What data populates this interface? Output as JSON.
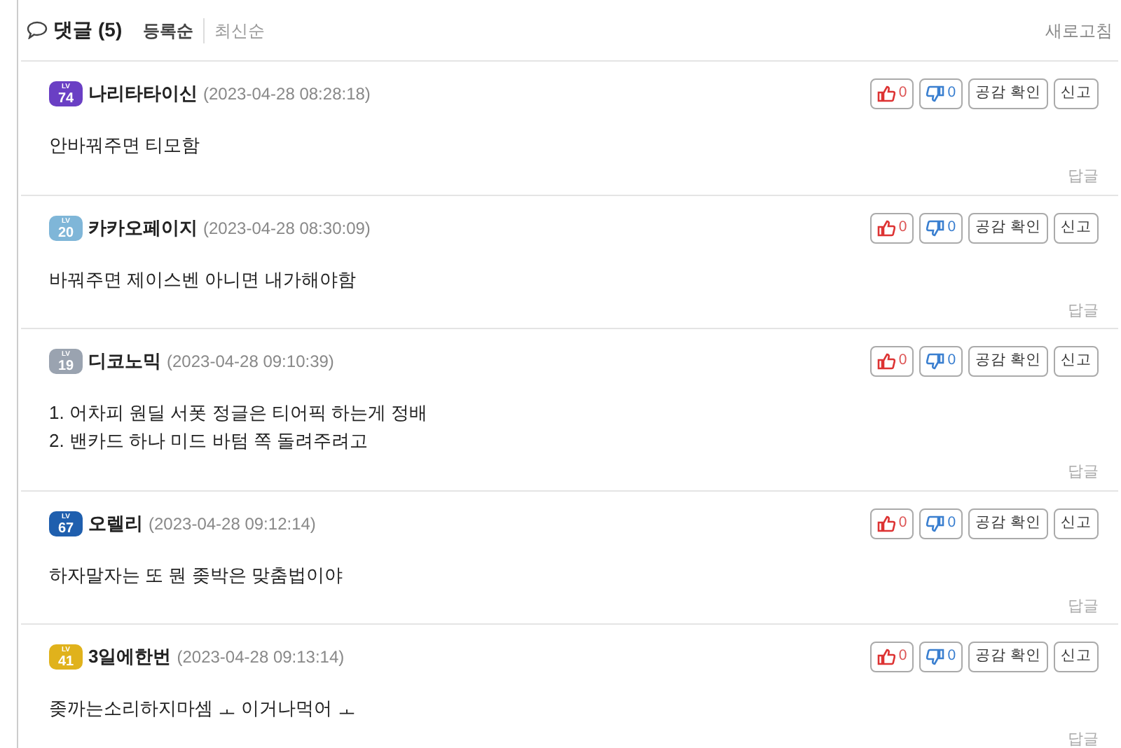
{
  "header": {
    "title": "댓글",
    "count": "(5)",
    "sorts": [
      {
        "label": "등록순",
        "selected": true
      },
      {
        "label": "최신순",
        "selected": false
      }
    ],
    "refresh": "새로고침"
  },
  "comments": [
    {
      "badge": {
        "caption": "LV",
        "number": "74",
        "color": "#6a3fc4"
      },
      "name": "나리타타이신",
      "date": "(2023-04-28 08:28:18)",
      "lines": [
        "안바꿔주면 티모함"
      ],
      "likes": "0",
      "dislikes": "0",
      "empathy": "공감 확인",
      "report": "신고",
      "reply": "답글"
    },
    {
      "badge": {
        "caption": "LV",
        "number": "20",
        "color": "#7fb6d8"
      },
      "name": "카카오페이지",
      "date": "(2023-04-28 08:30:09)",
      "lines": [
        "바꿔주면 제이스벤 아니면 내가해야함"
      ],
      "likes": "0",
      "dislikes": "0",
      "empathy": "공감 확인",
      "report": "신고",
      "reply": "답글"
    },
    {
      "badge": {
        "caption": "LV",
        "number": "19",
        "color": "#9aa3b0"
      },
      "name": "디코노믹",
      "date": "(2023-04-28 09:10:39)",
      "lines": [
        "1. 어차피 원딜 서폿 정글은 티어픽 하는게 정배",
        "2. 밴카드 하나 미드 바텀 쪽 돌려주려고"
      ],
      "likes": "0",
      "dislikes": "0",
      "empathy": "공감 확인",
      "report": "신고",
      "reply": "답글"
    },
    {
      "badge": {
        "caption": "LV",
        "number": "67",
        "color": "#1f5fae"
      },
      "name": "오렐리",
      "date": "(2023-04-28 09:12:14)",
      "lines": [
        "하자말자는 또 뭔 좆박은 맞춤법이야"
      ],
      "likes": "0",
      "dislikes": "0",
      "empathy": "공감 확인",
      "report": "신고",
      "reply": "답글"
    },
    {
      "badge": {
        "caption": "LV",
        "number": "41",
        "color": "#e0b21c"
      },
      "name": "3일에한번",
      "date": "(2023-04-28 09:13:14)",
      "lines": [
        "좆까는소리하지마셈 ㅗ 이거나먹어 ㅗ"
      ],
      "likes": "0",
      "dislikes": "0",
      "empathy": "공감 확인",
      "report": "신고",
      "reply": "답글"
    }
  ]
}
